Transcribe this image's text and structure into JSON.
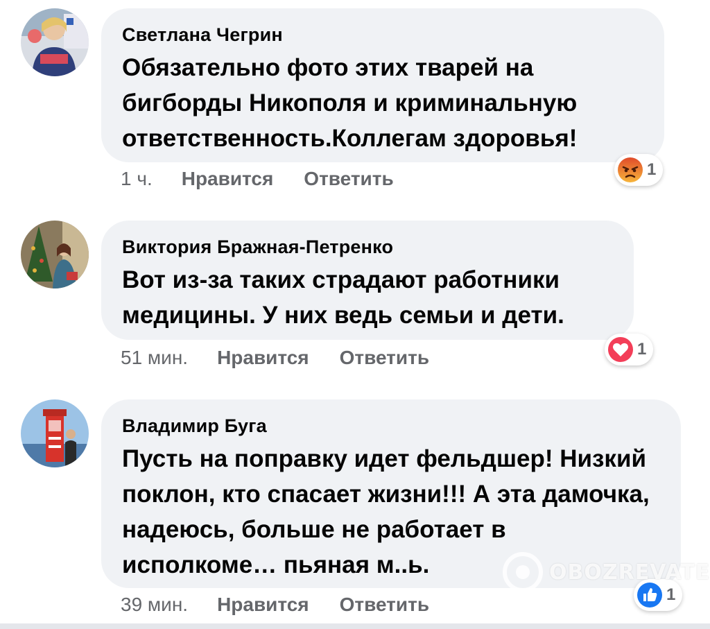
{
  "comments": [
    {
      "author": "Светлана Чегрин",
      "text": "Обязательно фото этих тварей на бигборды Никополя и криминальную ответственность.Коллегам здоровья!",
      "time": "1 ч.",
      "like_label": "Нравится",
      "reply_label": "Ответить",
      "reaction_icon": "angry-icon",
      "reaction_count": "1"
    },
    {
      "author": "Виктория Бражная-Петренко",
      "text": "Вот из-за таких страдают работники медицины.  У них ведь семьи и дети.",
      "time": "51 мин.",
      "like_label": "Нравится",
      "reply_label": "Ответить",
      "reaction_icon": "heart-icon",
      "reaction_count": "1"
    },
    {
      "author": "Владимир Буга",
      "text": "Пусть на поправку идет фельдшер! Низкий поклон, кто спасает жизни!!! А эта дамочка, надеюсь, больше не работает в исполкоме… пьяная м..ь.",
      "time": "39 мин.",
      "like_label": "Нравится",
      "reply_label": "Ответить",
      "reaction_icon": "thumbs-up-icon",
      "reaction_count": "1"
    }
  ],
  "watermark": "OBOZREVATEL",
  "colors": {
    "bubble": "#f0f2f5",
    "meta_text": "#65676b",
    "body_text": "#050505",
    "angry": "#f28f2a",
    "love": "#f33e58",
    "like": "#1877f2"
  }
}
